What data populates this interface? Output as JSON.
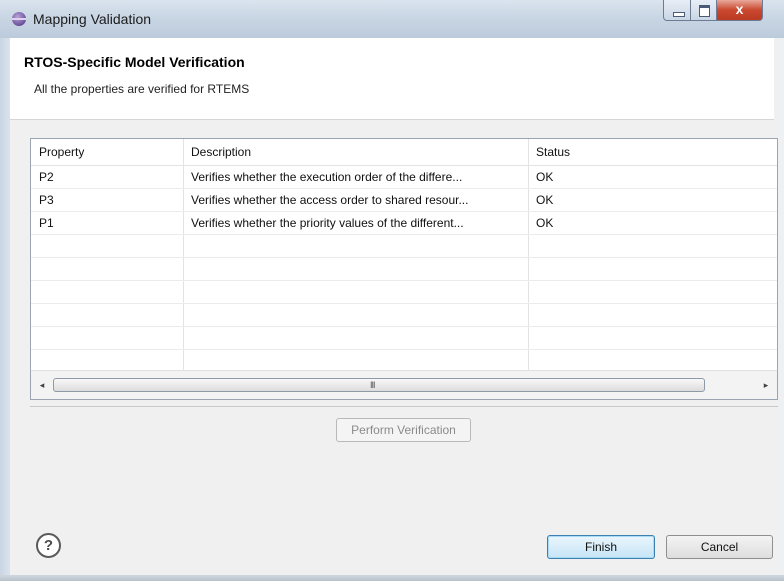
{
  "window": {
    "title": "Mapping Validation",
    "close_glyph": "x",
    "icons": {
      "app": "eclipse-icon",
      "minimize": "minimize-icon",
      "maximize": "maximize-icon",
      "close": "close-icon"
    }
  },
  "header": {
    "title": "RTOS-Specific Model Verification",
    "subtitle": "All the properties are verified for RTEMS"
  },
  "table": {
    "columns": [
      "Property",
      "Description",
      "Status"
    ],
    "rows": [
      {
        "property": "P2",
        "description": "Verifies whether the execution order of the differe...",
        "status": "OK"
      },
      {
        "property": "P3",
        "description": "Verifies whether the access order to shared resour...",
        "status": "OK"
      },
      {
        "property": "P1",
        "description": "Verifies whether the priority values of the different...",
        "status": "OK"
      }
    ],
    "scroll": {
      "left_arrow": "◂",
      "right_arrow": "▸",
      "grip": "III"
    }
  },
  "buttons": {
    "perform": "Perform Verification",
    "finish": "Finish",
    "cancel": "Cancel",
    "help": "?"
  },
  "colors": {
    "close_red": "#c9482f",
    "focus_blue": "#3c7fb1"
  }
}
